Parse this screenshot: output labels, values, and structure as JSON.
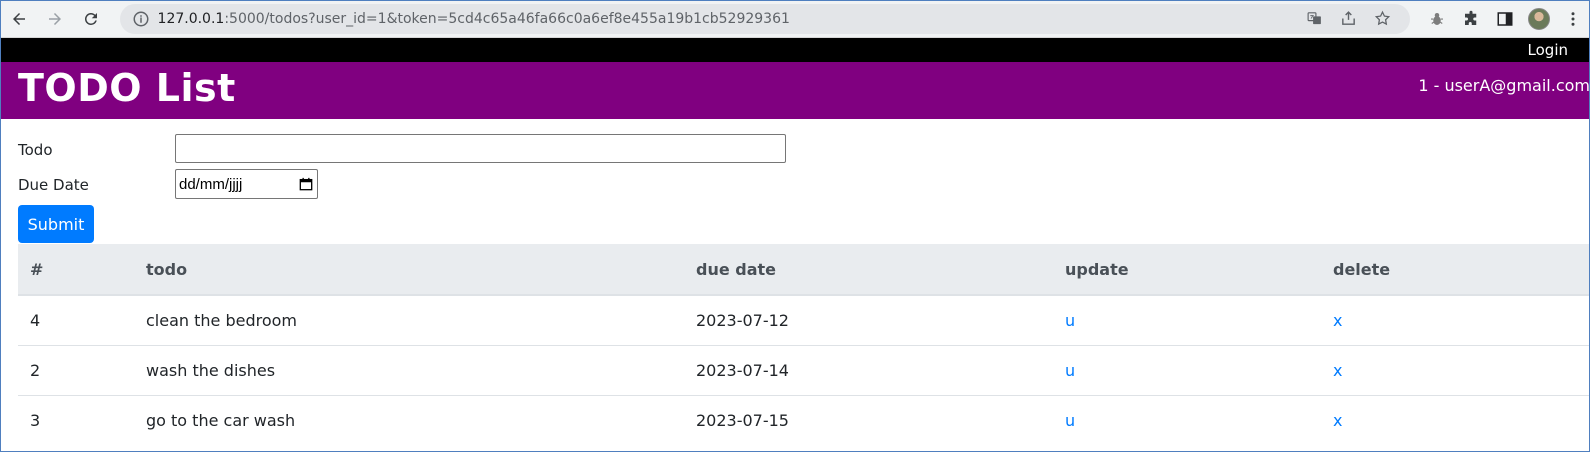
{
  "browser": {
    "url_host": "127.0.0.1",
    "url_rest": ":5000/todos?user_id=1&token=5cd4c65a46fa66c0a6ef8e455a19b1cb52929361"
  },
  "topbar": {
    "login_label": "Login"
  },
  "header": {
    "title": "TODO List",
    "user": "1 - userA@gmail.com"
  },
  "form": {
    "todo_label": "Todo",
    "todo_value": "",
    "due_label": "Due Date",
    "due_placeholder": "dd/mm/jjjj",
    "submit_label": "Submit"
  },
  "table": {
    "headers": [
      "#",
      "todo",
      "due date",
      "update",
      "delete"
    ],
    "rows": [
      {
        "id": "4",
        "todo": "clean the bedroom",
        "due": "2023-07-12",
        "update": "u",
        "delete": "x"
      },
      {
        "id": "2",
        "todo": "wash the dishes",
        "due": "2023-07-14",
        "update": "u",
        "delete": "x"
      },
      {
        "id": "3",
        "todo": "go to the car wash",
        "due": "2023-07-15",
        "update": "u",
        "delete": "x"
      }
    ]
  },
  "colors": {
    "header_bg": "#800080",
    "topbar_bg": "#000000",
    "primary": "#007bff"
  }
}
